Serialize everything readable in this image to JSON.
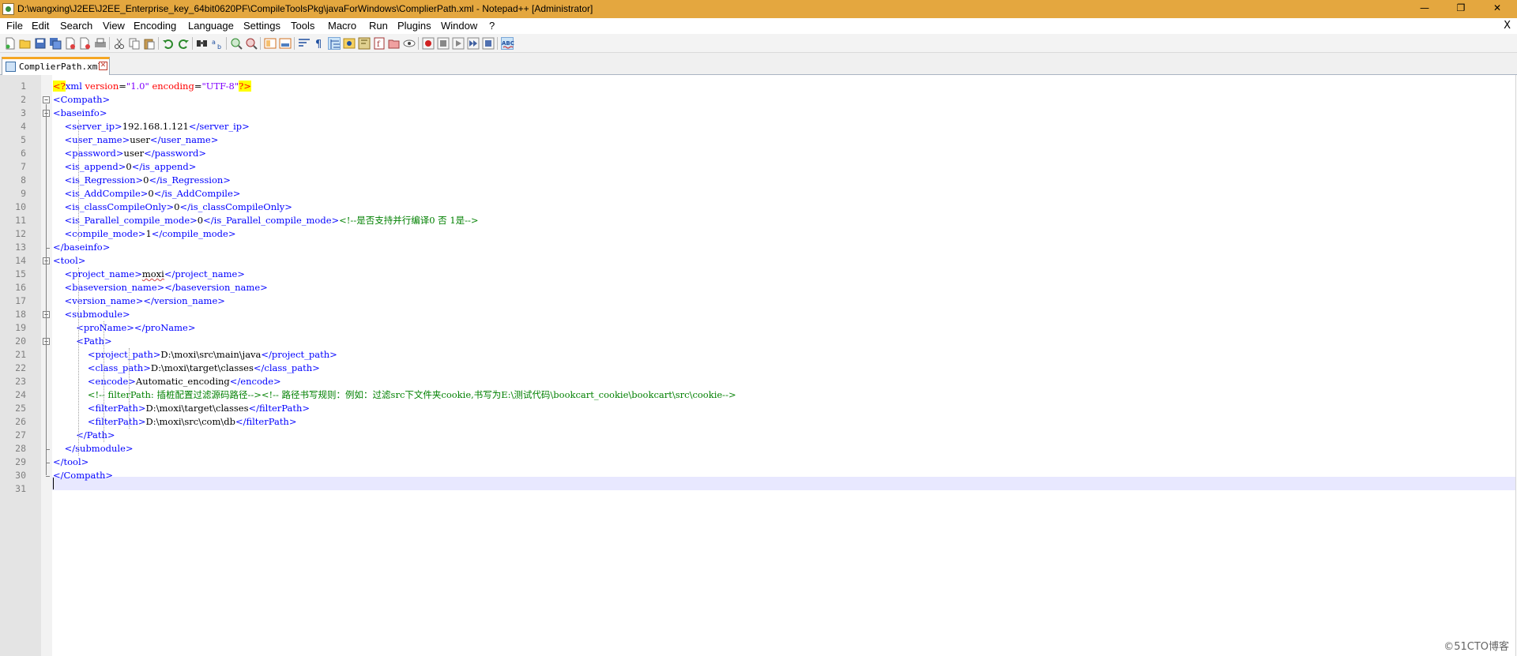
{
  "window": {
    "title": "D:\\wangxing\\J2EE\\J2EE_Enterprise_key_64bit0620PF\\CompileToolsPkg\\javaForWindows\\ComplierPath.xml - Notepad++ [Administrator]",
    "minimize": "—",
    "restore": "❐",
    "close": "✕"
  },
  "menu": {
    "items": [
      "File",
      "Edit",
      "Search",
      "View",
      "Encoding",
      "Language",
      "Settings",
      "Tools",
      "Macro",
      "Run",
      "Plugins",
      "Window",
      "?"
    ],
    "close_glyph": "X"
  },
  "toolbar": {
    "icons": [
      "new-file-icon",
      "open-file-icon",
      "save-icon",
      "save-all-icon",
      "close-icon",
      "close-all-icon",
      "print-icon",
      "cut-icon",
      "copy-icon",
      "paste-icon",
      "undo-icon",
      "redo-icon",
      "find-icon",
      "replace-icon",
      "zoom-in-icon",
      "zoom-out-icon",
      "sync-vertical-icon",
      "sync-horizontal-icon",
      "word-wrap-icon",
      "show-all-chars-icon",
      "indent-guide-icon",
      "udl-icon",
      "doc-map-icon",
      "function-list-icon",
      "folder-as-workspace-icon",
      "monitoring-icon",
      "record-macro-icon",
      "stop-record-icon",
      "play-macro-icon",
      "run-macro-multiple-icon",
      "save-macro-icon",
      "spell-check-icon"
    ]
  },
  "tab": {
    "label": "ComplierPath.xml"
  },
  "editor": {
    "line_numbers": [
      "1",
      "2",
      "3",
      "4",
      "5",
      "6",
      "7",
      "8",
      "9",
      "10",
      "11",
      "12",
      "13",
      "14",
      "15",
      "16",
      "17",
      "18",
      "19",
      "20",
      "21",
      "22",
      "23",
      "24",
      "25",
      "26",
      "27",
      "28",
      "29",
      "30",
      "31"
    ],
    "lines": [
      [
        {
          "c": "pi",
          "t": "<?"
        },
        {
          "c": "tag",
          "t": "xml "
        },
        {
          "c": "attr",
          "t": "version"
        },
        {
          "c": "txt",
          "t": "="
        },
        {
          "c": "val",
          "t": "\"1.0\""
        },
        {
          "c": "txt",
          "t": " "
        },
        {
          "c": "attr",
          "t": "encoding"
        },
        {
          "c": "txt",
          "t": "="
        },
        {
          "c": "val",
          "t": "\"UTF-8\""
        },
        {
          "c": "pi",
          "t": "?>"
        }
      ],
      [
        {
          "c": "tag",
          "t": "<Compath>"
        }
      ],
      [
        {
          "c": "tag",
          "t": "<baseinfo>"
        }
      ],
      [
        {
          "c": "txt",
          "t": "    "
        },
        {
          "c": "tag",
          "t": "<server_ip>"
        },
        {
          "c": "txt",
          "t": "192.168.1.121"
        },
        {
          "c": "tag",
          "t": "</server_ip>"
        }
      ],
      [
        {
          "c": "txt",
          "t": "    "
        },
        {
          "c": "tag",
          "t": "<user_name>"
        },
        {
          "c": "txt",
          "t": "user"
        },
        {
          "c": "tag",
          "t": "</user_name>"
        }
      ],
      [
        {
          "c": "txt",
          "t": "    "
        },
        {
          "c": "tag",
          "t": "<password>"
        },
        {
          "c": "txt",
          "t": "user"
        },
        {
          "c": "tag",
          "t": "</password>"
        }
      ],
      [
        {
          "c": "txt",
          "t": "    "
        },
        {
          "c": "tag",
          "t": "<is_append>"
        },
        {
          "c": "txt",
          "t": "0"
        },
        {
          "c": "tag",
          "t": "</is_append>"
        }
      ],
      [
        {
          "c": "txt",
          "t": "    "
        },
        {
          "c": "tag",
          "t": "<is_Regression>"
        },
        {
          "c": "txt",
          "t": "0"
        },
        {
          "c": "tag",
          "t": "</is_Regression>"
        }
      ],
      [
        {
          "c": "txt",
          "t": "    "
        },
        {
          "c": "tag",
          "t": "<is_AddCompile>"
        },
        {
          "c": "txt",
          "t": "0"
        },
        {
          "c": "tag",
          "t": "</is_AddCompile>"
        }
      ],
      [
        {
          "c": "txt",
          "t": "    "
        },
        {
          "c": "tag",
          "t": "<is_classCompileOnly>"
        },
        {
          "c": "txt",
          "t": "0"
        },
        {
          "c": "tag",
          "t": "</is_classCompileOnly>"
        }
      ],
      [
        {
          "c": "txt",
          "t": "    "
        },
        {
          "c": "tag",
          "t": "<is_Parallel_compile_mode>"
        },
        {
          "c": "txt",
          "t": "0"
        },
        {
          "c": "tag",
          "t": "</is_Parallel_compile_mode>"
        },
        {
          "c": "cmt",
          "t": "<!--是否支持并行编译0 否 1是-->"
        }
      ],
      [
        {
          "c": "txt",
          "t": "    "
        },
        {
          "c": "tag",
          "t": "<compile_mode>"
        },
        {
          "c": "txt",
          "t": "1"
        },
        {
          "c": "tag",
          "t": "</compile_mode>"
        }
      ],
      [
        {
          "c": "tag",
          "t": "</baseinfo>"
        }
      ],
      [
        {
          "c": "tag",
          "t": "<tool>"
        }
      ],
      [
        {
          "c": "txt",
          "t": "    "
        },
        {
          "c": "tag",
          "t": "<project_name>"
        },
        {
          "c": "txt sq",
          "t": "moxi"
        },
        {
          "c": "tag",
          "t": "</project_name>"
        }
      ],
      [
        {
          "c": "txt",
          "t": "    "
        },
        {
          "c": "tag",
          "t": "<baseversion_name></baseversion_name>"
        }
      ],
      [
        {
          "c": "txt",
          "t": "    "
        },
        {
          "c": "tag",
          "t": "<version_name></version_name>"
        }
      ],
      [
        {
          "c": "txt",
          "t": "    "
        },
        {
          "c": "tag",
          "t": "<submodule>"
        }
      ],
      [
        {
          "c": "txt",
          "t": "        "
        },
        {
          "c": "tag",
          "t": "<proName></proName>"
        }
      ],
      [
        {
          "c": "txt",
          "t": "        "
        },
        {
          "c": "tag",
          "t": "<Path>"
        }
      ],
      [
        {
          "c": "txt",
          "t": "            "
        },
        {
          "c": "tag",
          "t": "<project_path>"
        },
        {
          "c": "txt",
          "t": "D:\\moxi\\src\\main\\java"
        },
        {
          "c": "tag",
          "t": "</project_path>"
        }
      ],
      [
        {
          "c": "txt",
          "t": "            "
        },
        {
          "c": "tag",
          "t": "<class_path>"
        },
        {
          "c": "txt",
          "t": "D:\\moxi\\target\\classes"
        },
        {
          "c": "tag",
          "t": "</class_path>"
        }
      ],
      [
        {
          "c": "txt",
          "t": "            "
        },
        {
          "c": "tag",
          "t": "<encode>"
        },
        {
          "c": "txt",
          "t": "Automatic_encoding"
        },
        {
          "c": "tag",
          "t": "</encode>"
        }
      ],
      [
        {
          "c": "txt",
          "t": "            "
        },
        {
          "c": "cmt",
          "t": "<!-- filterPath: 插桩配置过滤源码路径--><!-- 路径书写规则：例如：过滤src下文件夹cookie,书写为E:\\测试代码\\bookcart_cookie\\bookcart\\src\\cookie-->"
        }
      ],
      [
        {
          "c": "txt",
          "t": "            "
        },
        {
          "c": "tag",
          "t": "<filterPath>"
        },
        {
          "c": "txt",
          "t": "D:\\moxi\\target\\classes"
        },
        {
          "c": "tag",
          "t": "</filterPath>"
        }
      ],
      [
        {
          "c": "txt",
          "t": "            "
        },
        {
          "c": "tag",
          "t": "<filterPath>"
        },
        {
          "c": "txt",
          "t": "D:\\moxi\\src\\com\\db"
        },
        {
          "c": "tag",
          "t": "</filterPath>"
        }
      ],
      [
        {
          "c": "txt",
          "t": "        "
        },
        {
          "c": "tag",
          "t": "</Path>"
        }
      ],
      [
        {
          "c": "txt",
          "t": "    "
        },
        {
          "c": "tag",
          "t": "</submodule>"
        }
      ],
      [
        {
          "c": "tag",
          "t": "</tool>"
        }
      ],
      [
        {
          "c": "tag",
          "t": "</Compath>"
        }
      ],
      []
    ]
  },
  "watermark": "©51CTO博客"
}
